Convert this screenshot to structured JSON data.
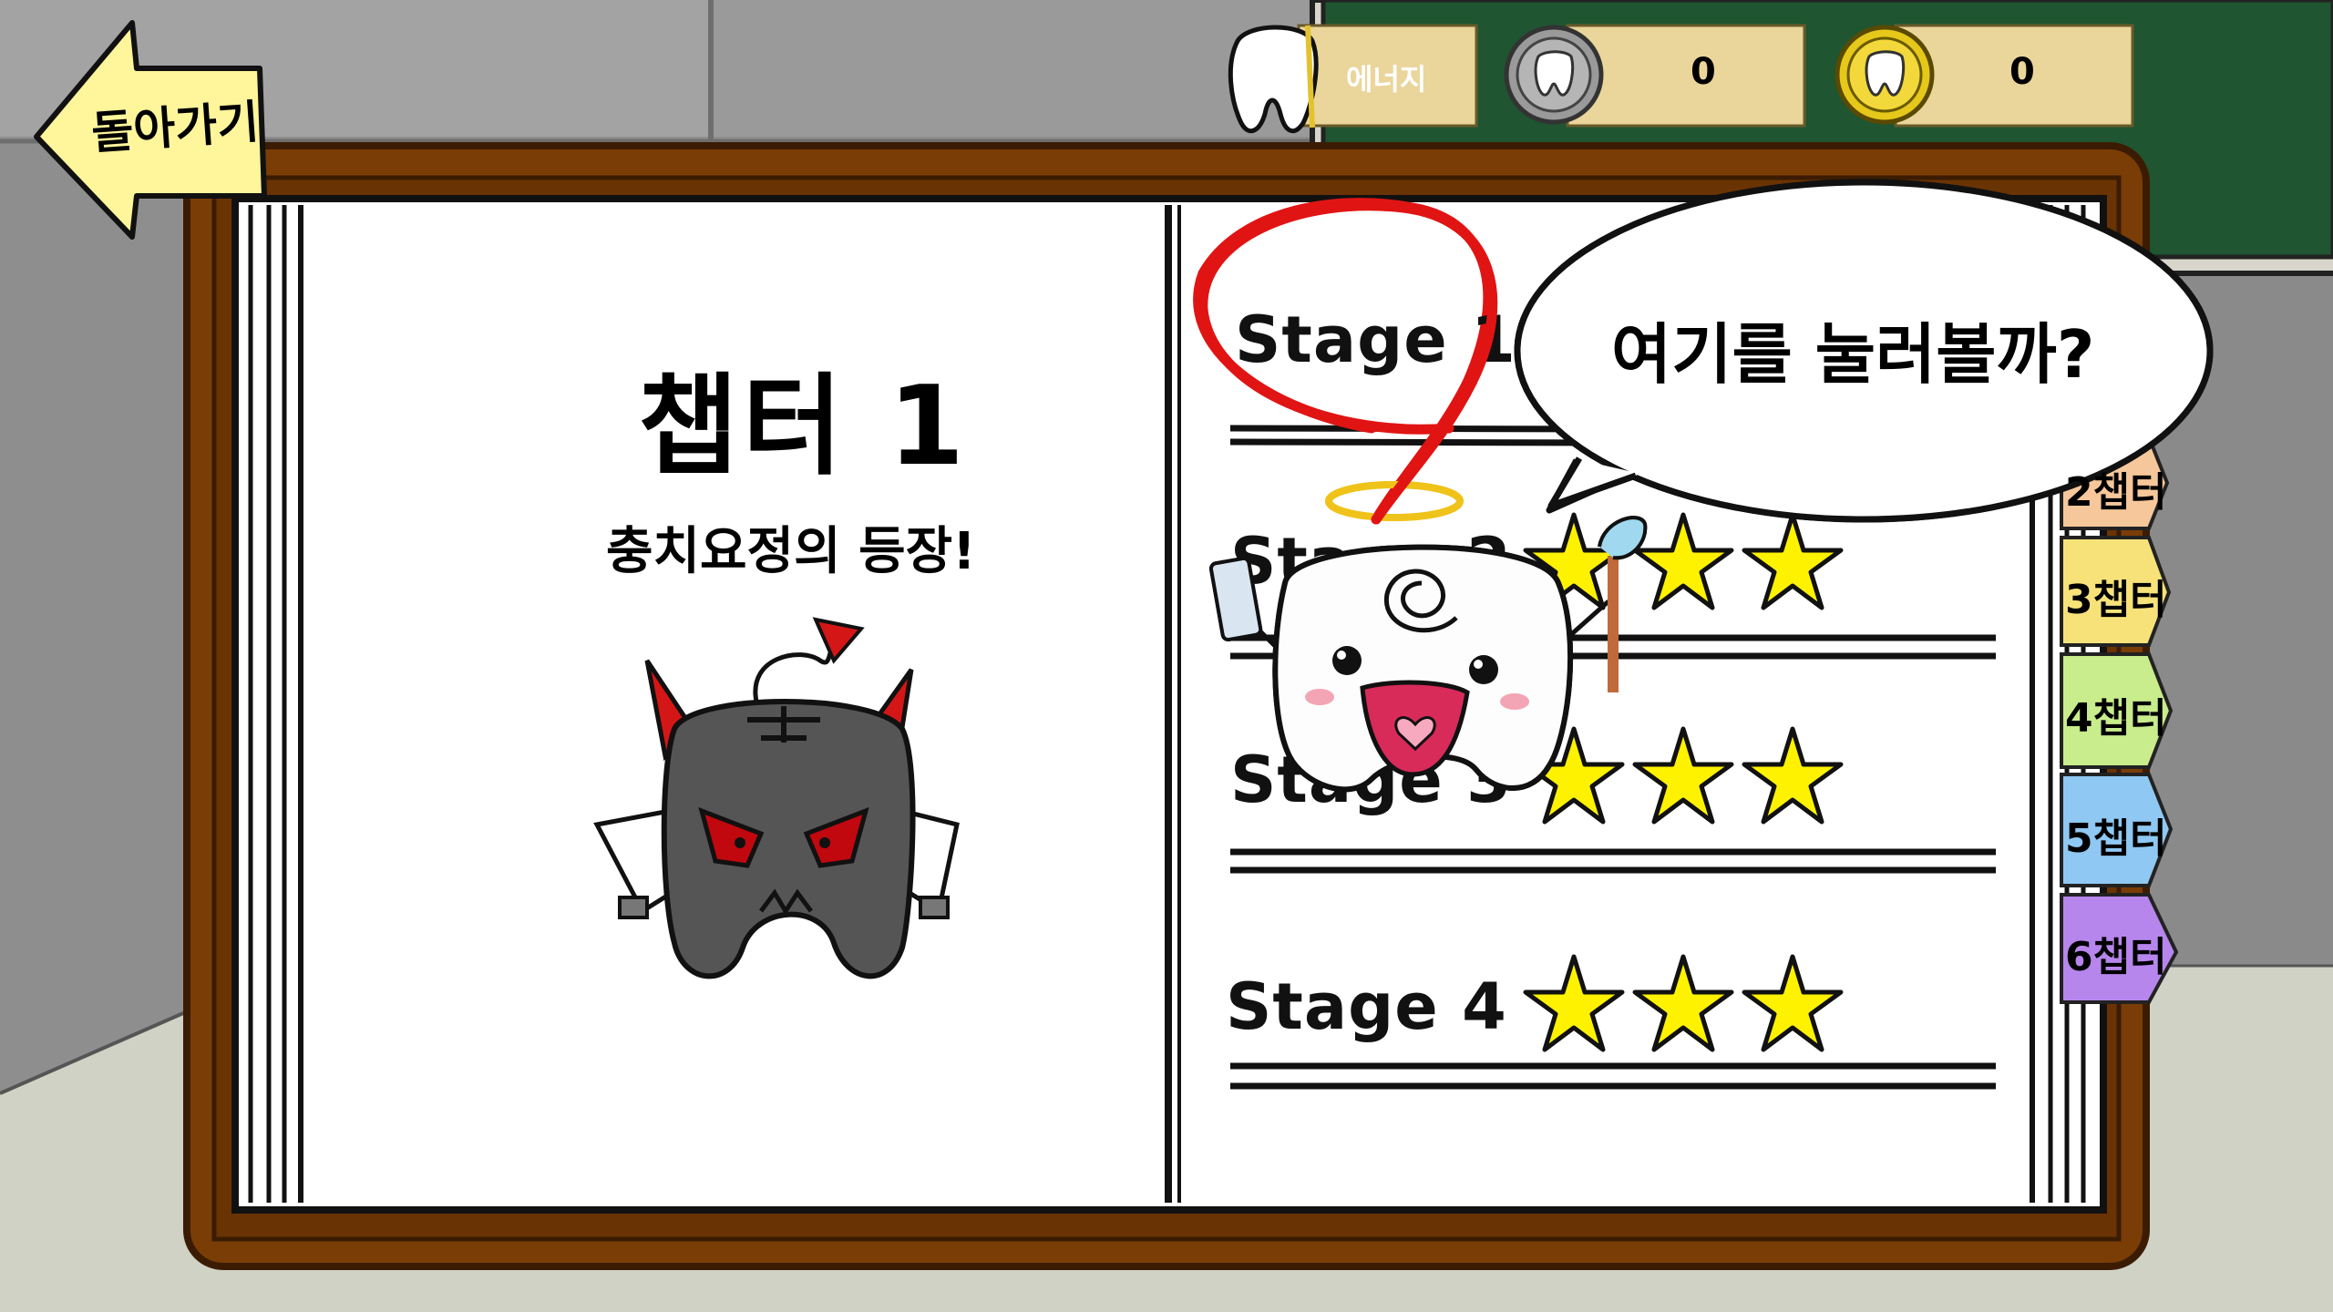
{
  "back_button": {
    "label": "돌아가기"
  },
  "hud": {
    "energy_label": "에너지",
    "silver_coin_count": "0",
    "gold_coin_count": "0"
  },
  "chapter": {
    "title": "챕터 1",
    "subtitle": "충치요정의 등장!"
  },
  "stages": [
    {
      "label": "Stage 1"
    },
    {
      "label": "Stage 2"
    },
    {
      "label": "Stage 3",
      "stars": 3
    },
    {
      "label": "Stage 4",
      "stars": 3
    }
  ],
  "speech_bubble": {
    "text": "여기를 눌러볼까?"
  },
  "chapter_tabs": [
    {
      "label": "2챕터",
      "color": "#f5c79a"
    },
    {
      "label": "3챕터",
      "color": "#f7e27a"
    },
    {
      "label": "4챕터",
      "color": "#c9ec8c"
    },
    {
      "label": "5챕터",
      "color": "#8fc8f2"
    },
    {
      "label": "6챕터",
      "color": "#b786ec"
    }
  ],
  "colors": {
    "board_frame": "#7a3d06",
    "chalkboard": "#1f5531",
    "highlight_circle": "#e11414",
    "star": "#fff200",
    "back_arrow": "#fff59b"
  }
}
